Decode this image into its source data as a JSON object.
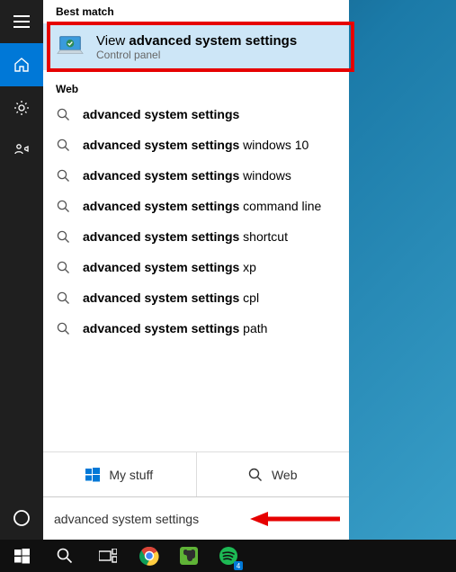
{
  "section_best": "Best match",
  "best_match": {
    "title_prefix": "View ",
    "title_bold": "advanced system settings",
    "sub": "Control panel"
  },
  "section_web": "Web",
  "suggestions": [
    {
      "bold": "advanced system settings",
      "rest": ""
    },
    {
      "bold": "advanced system settings",
      "rest": " windows 10"
    },
    {
      "bold": "advanced system settings",
      "rest": " windows"
    },
    {
      "bold": "advanced system settings",
      "rest": " command line"
    },
    {
      "bold": "advanced system settings",
      "rest": " shortcut"
    },
    {
      "bold": "advanced system settings",
      "rest": " xp"
    },
    {
      "bold": "advanced system settings",
      "rest": " cpl"
    },
    {
      "bold": "advanced system settings",
      "rest": " path"
    }
  ],
  "filters": {
    "mystuff": "My stuff",
    "web": "Web"
  },
  "search_value": "advanced system settings",
  "spotify_badge": "4"
}
